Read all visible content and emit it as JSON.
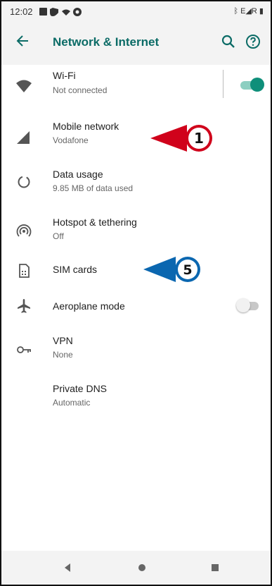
{
  "status_bar": {
    "time": "12:02",
    "right_text": "ᛒ E◢R ▮"
  },
  "app_bar": {
    "title": "Network & Internet"
  },
  "items": [
    {
      "label": "Wi-Fi",
      "subtitle": "Not connected"
    },
    {
      "label": "Mobile network",
      "subtitle": "Vodafone"
    },
    {
      "label": "Data usage",
      "subtitle": "9.85 MB of data used"
    },
    {
      "label": "Hotspot & tethering",
      "subtitle": "Off"
    },
    {
      "label": "SIM cards"
    },
    {
      "label": "Aeroplane mode"
    },
    {
      "label": "VPN",
      "subtitle": "None"
    },
    {
      "label": "Private DNS",
      "subtitle": "Automatic"
    }
  ],
  "callouts": [
    {
      "number": "1",
      "color": "#d0021b"
    },
    {
      "number": "5",
      "color": "#0b67b0"
    }
  ],
  "colors": {
    "accent": "#0b6b66",
    "toggle_on": "#0f8f7a",
    "toggle_on_track": "#8ccfc1"
  },
  "toggles": {
    "wifi_on": true,
    "aeroplane_on": false
  }
}
